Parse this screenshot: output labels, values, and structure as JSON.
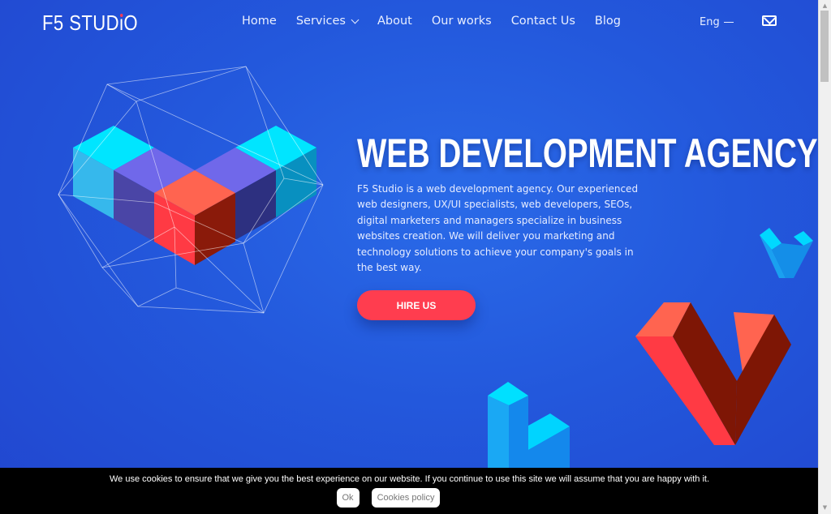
{
  "header": {
    "logo_prefix": "F5 STUD",
    "logo_dot_letter": "i",
    "logo_suffix": "O",
    "nav": [
      {
        "label": "Home"
      },
      {
        "label": "Services",
        "has_dropdown": true
      },
      {
        "label": "About"
      },
      {
        "label": "Our works"
      },
      {
        "label": "Contact Us"
      },
      {
        "label": "Blog"
      }
    ],
    "language": "Eng",
    "mail_icon": "envelope-icon"
  },
  "hero": {
    "title": "WEB DEVELOPMENT AGENCY",
    "description": "F5 Studio is a web development agency. Our experienced web designers, UX/UI specialists, web developers, SEOs, digital marketers and managers specialize in business websites creation. We will deliver you marketing and technology solutions to achieve your company's goals in the best way.",
    "cta_label": "HIRE US"
  },
  "colors": {
    "background": "#2358dc",
    "accent_red": "#ff3d4f",
    "cyan": "#00e5ff",
    "violet": "#6e6ae8",
    "dark_red": "#8a1a0a"
  },
  "cookie_banner": {
    "text": "We use cookies to ensure that we give you the best experience on our website. If you continue to use this site we will assume that you are happy with it.",
    "ok_label": "Ok",
    "policy_label": "Cookies policy"
  }
}
